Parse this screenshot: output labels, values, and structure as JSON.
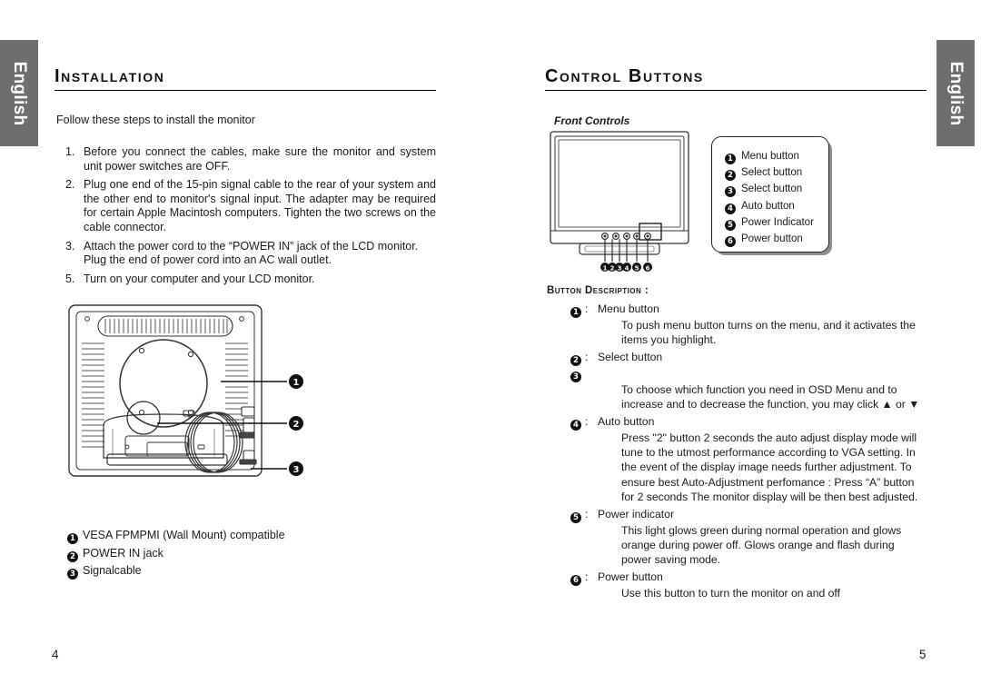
{
  "sidebar": {
    "left_label": "English",
    "right_label": "English",
    "color": "#6e6e6e"
  },
  "left_page": {
    "heading": "Installation",
    "intro": "Follow these steps to install the monitor",
    "steps": [
      {
        "num": "1.",
        "text": "Before you connect the cables, make sure the monitor and system unit power switches are OFF."
      },
      {
        "num": "2.",
        "text": "Plug one end of the 15-pin signal cable to the rear of your system and the other end to monitor's signal input. The adapter may be required for certain Apple Macintosh computers. Tighten the two screws on the cable connector."
      },
      {
        "num": "3.",
        "text": "Attach the power cord to the “POWER IN” jack of the LCD monitor. Plug the end of power cord into an AC wall outlet."
      },
      {
        "num": "5.",
        "text": "Turn on your computer and your LCD monitor."
      }
    ],
    "diagram_name": "monitor-rear-view-diagram",
    "diagram_callouts": [
      "1",
      "2",
      "3"
    ],
    "legend": [
      {
        "marker": "1",
        "text": "VESA FPMPMI (Wall Mount) compatible"
      },
      {
        "marker": "2",
        "text": "POWER IN jack"
      },
      {
        "marker": "3",
        "text": "Signalcable"
      }
    ],
    "page_number": "4"
  },
  "right_page": {
    "heading": "Control Buttons",
    "subheading": "Front Controls",
    "diagram_name": "monitor-front-view-diagram",
    "front_button_markers": [
      "1",
      "2",
      "3",
      "4",
      "5",
      "6"
    ],
    "callout_box": [
      {
        "marker": "1",
        "label": "Menu button"
      },
      {
        "marker": "2",
        "label": "Select button"
      },
      {
        "marker": "3",
        "label": "Select button"
      },
      {
        "marker": "4",
        "label": "Auto button"
      },
      {
        "marker": "5",
        "label": "Power Indicator"
      },
      {
        "marker": "6",
        "label": "Power button"
      }
    ],
    "description_heading": "Button Description :",
    "descriptions": [
      {
        "markers": [
          "1"
        ],
        "colon": ":",
        "label": "Menu button",
        "body": "To push menu button turns on the menu, and it activates the items you highlight."
      },
      {
        "markers": [
          "2",
          "3"
        ],
        "colon": ":",
        "label": "Select button",
        "body": "To choose which function you need in OSD Menu and to increase and to decrease the function, you may click ▲ or ▼"
      },
      {
        "markers": [
          "4"
        ],
        "colon": ":",
        "label": "Auto button",
        "body": "Press \"2\" button 2 seconds the auto adjust display mode will tune to the utmost performance according to VGA setting. In the event of the display image needs further adjustment. To ensure best Auto-Adjustment perfomance : Press “A” button for 2 seconds The monitor display will be then best adjusted."
      },
      {
        "markers": [
          "5"
        ],
        "colon": ":",
        "label": "Power indicator",
        "body": "This light glows green during normal operation and glows orange during power off. Glows orange and flash during power saving mode."
      },
      {
        "markers": [
          "6"
        ],
        "colon": ":",
        "label": "Power button",
        "body": "Use this button to turn the monitor on and off"
      }
    ],
    "page_number": "5"
  }
}
